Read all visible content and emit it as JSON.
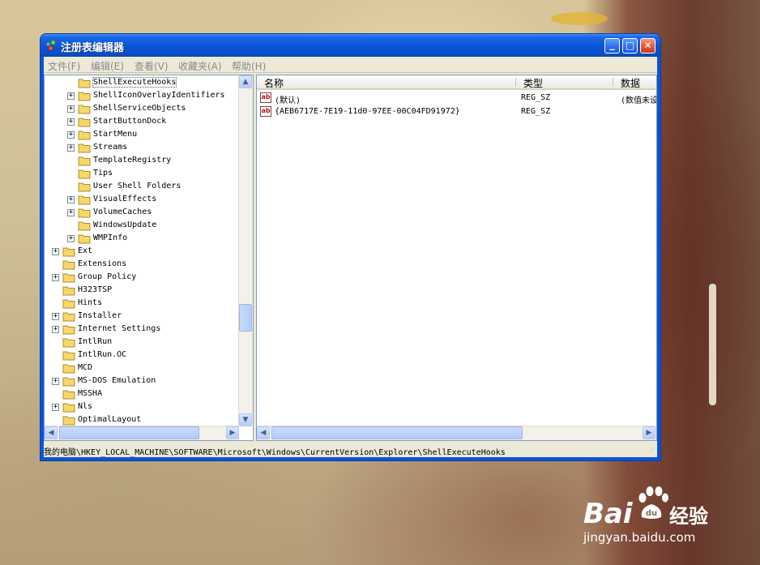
{
  "window": {
    "title": "注册表编辑器",
    "controls": {
      "minimize": "_",
      "maximize": "□",
      "close": "✕"
    }
  },
  "menu": [
    "文件(F)",
    "编辑(E)",
    "查看(V)",
    "收藏夹(A)",
    "帮助(H)"
  ],
  "tree": [
    {
      "label": "ShellExecuteHooks",
      "expander": "",
      "depth": 2,
      "selected": true
    },
    {
      "label": "ShellIconOverlayIdentifiers",
      "expander": "+",
      "depth": 2
    },
    {
      "label": "ShellServiceObjects",
      "expander": "+",
      "depth": 2
    },
    {
      "label": "StartButtonDock",
      "expander": "+",
      "depth": 2
    },
    {
      "label": "StartMenu",
      "expander": "+",
      "depth": 2
    },
    {
      "label": "Streams",
      "expander": "+",
      "depth": 2
    },
    {
      "label": "TemplateRegistry",
      "expander": "",
      "depth": 2
    },
    {
      "label": "Tips",
      "expander": "",
      "depth": 2
    },
    {
      "label": "User Shell Folders",
      "expander": "",
      "depth": 2
    },
    {
      "label": "VisualEffects",
      "expander": "+",
      "depth": 2
    },
    {
      "label": "VolumeCaches",
      "expander": "+",
      "depth": 2
    },
    {
      "label": "WindowsUpdate",
      "expander": "",
      "depth": 2
    },
    {
      "label": "WMPInfo",
      "expander": "+",
      "depth": 2
    },
    {
      "label": "Ext",
      "expander": "+",
      "depth": 1
    },
    {
      "label": "Extensions",
      "expander": "",
      "depth": 1
    },
    {
      "label": "Group Policy",
      "expander": "+",
      "depth": 1
    },
    {
      "label": "H323TSP",
      "expander": "",
      "depth": 1
    },
    {
      "label": "Hints",
      "expander": "",
      "depth": 1
    },
    {
      "label": "Installer",
      "expander": "+",
      "depth": 1
    },
    {
      "label": "Internet Settings",
      "expander": "+",
      "depth": 1
    },
    {
      "label": "IntlRun",
      "expander": "",
      "depth": 1
    },
    {
      "label": "IntlRun.OC",
      "expander": "",
      "depth": 1
    },
    {
      "label": "MCD",
      "expander": "",
      "depth": 1
    },
    {
      "label": "MS-DOS Emulation",
      "expander": "+",
      "depth": 1
    },
    {
      "label": "MSSHA",
      "expander": "",
      "depth": 1
    },
    {
      "label": "Nls",
      "expander": "+",
      "depth": 1
    },
    {
      "label": "OptimalLayout",
      "expander": "",
      "depth": 1
    }
  ],
  "columns": {
    "name": "名称",
    "type": "类型",
    "data": "数据"
  },
  "values": [
    {
      "name": "(默认)",
      "type": "REG_SZ",
      "data": "(数值未设"
    },
    {
      "name": "{AEB6717E-7E19-11d0-97EE-00C04FD91972}",
      "type": "REG_SZ",
      "data": ""
    }
  ],
  "status": "我的电脑\\HKEY_LOCAL_MACHINE\\SOFTWARE\\Microsoft\\Windows\\CurrentVersion\\Explorer\\ShellExecuteHooks",
  "watermark": {
    "brand": "Bai",
    "brand2": "经验",
    "url": "jingyan.baidu.com"
  },
  "colors": {
    "titlebar": "#0a55d6",
    "close": "#e2583a",
    "folder": "#f6d86a",
    "string_icon": "#b01818"
  }
}
